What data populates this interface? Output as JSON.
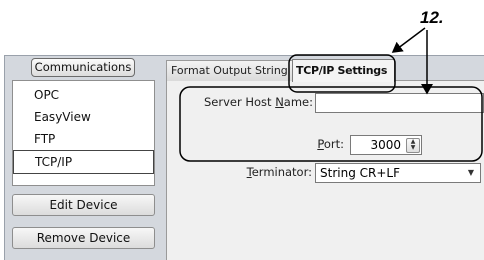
{
  "annotation": {
    "label": "12."
  },
  "left_panel": {
    "header": "Communications",
    "items": [
      {
        "label": "OPC"
      },
      {
        "label": "EasyView"
      },
      {
        "label": "FTP"
      },
      {
        "label": "TCP/IP",
        "selected": true
      }
    ],
    "edit_button": "Edit Device",
    "remove_button": "Remove Device"
  },
  "tabs": [
    {
      "label": "Format Output String"
    },
    {
      "label": "TCP/IP Settings",
      "active": true
    }
  ],
  "form": {
    "server_host": {
      "label_pre": "Server Host ",
      "label_key": "N",
      "label_post": "ame:",
      "value": ""
    },
    "port": {
      "label_key": "P",
      "label_post": "ort:",
      "value": "3000"
    },
    "terminator": {
      "label_key": "T",
      "label_post": "erminator:",
      "value": "String CR+LF"
    }
  },
  "icons": {
    "spin": "spin-updown-icon",
    "dropdown": "dropdown-arrow-icon"
  }
}
